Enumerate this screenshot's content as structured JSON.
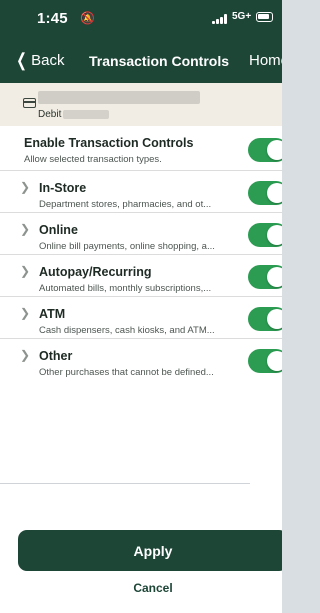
{
  "status_bar": {
    "time": "1:45",
    "network": "5G+"
  },
  "nav": {
    "back_label": "Back",
    "title": "Transaction Controls",
    "home_label": "Home"
  },
  "account": {
    "type_label": "Debit"
  },
  "master": {
    "label": "Enable Transaction Controls",
    "desc": "Allow selected transaction types.",
    "enabled": true
  },
  "categories": [
    {
      "label": "In-Store",
      "desc": "Department stores, pharmacies, and ot...",
      "enabled": true
    },
    {
      "label": "Online",
      "desc": "Online bill payments, online shopping, a...",
      "enabled": true
    },
    {
      "label": "Autopay/Recurring",
      "desc": "Automated bills, monthly subscriptions,...",
      "enabled": true
    },
    {
      "label": "ATM",
      "desc": "Cash dispensers, cash kiosks, and ATM...",
      "enabled": true
    },
    {
      "label": "Other",
      "desc": "Other purchases that cannot be defined...",
      "enabled": true
    }
  ],
  "actions": {
    "apply_label": "Apply",
    "cancel_label": "Cancel"
  },
  "colors": {
    "brand_green": "#1d4637",
    "toggle_on": "#2b9c52",
    "account_bg": "#f1ede4"
  },
  "icons": {
    "back": "chevron-left-icon",
    "card": "credit-card-icon",
    "row_expand": "chevron-right-icon",
    "bell_muted": "bell-slash-icon"
  }
}
